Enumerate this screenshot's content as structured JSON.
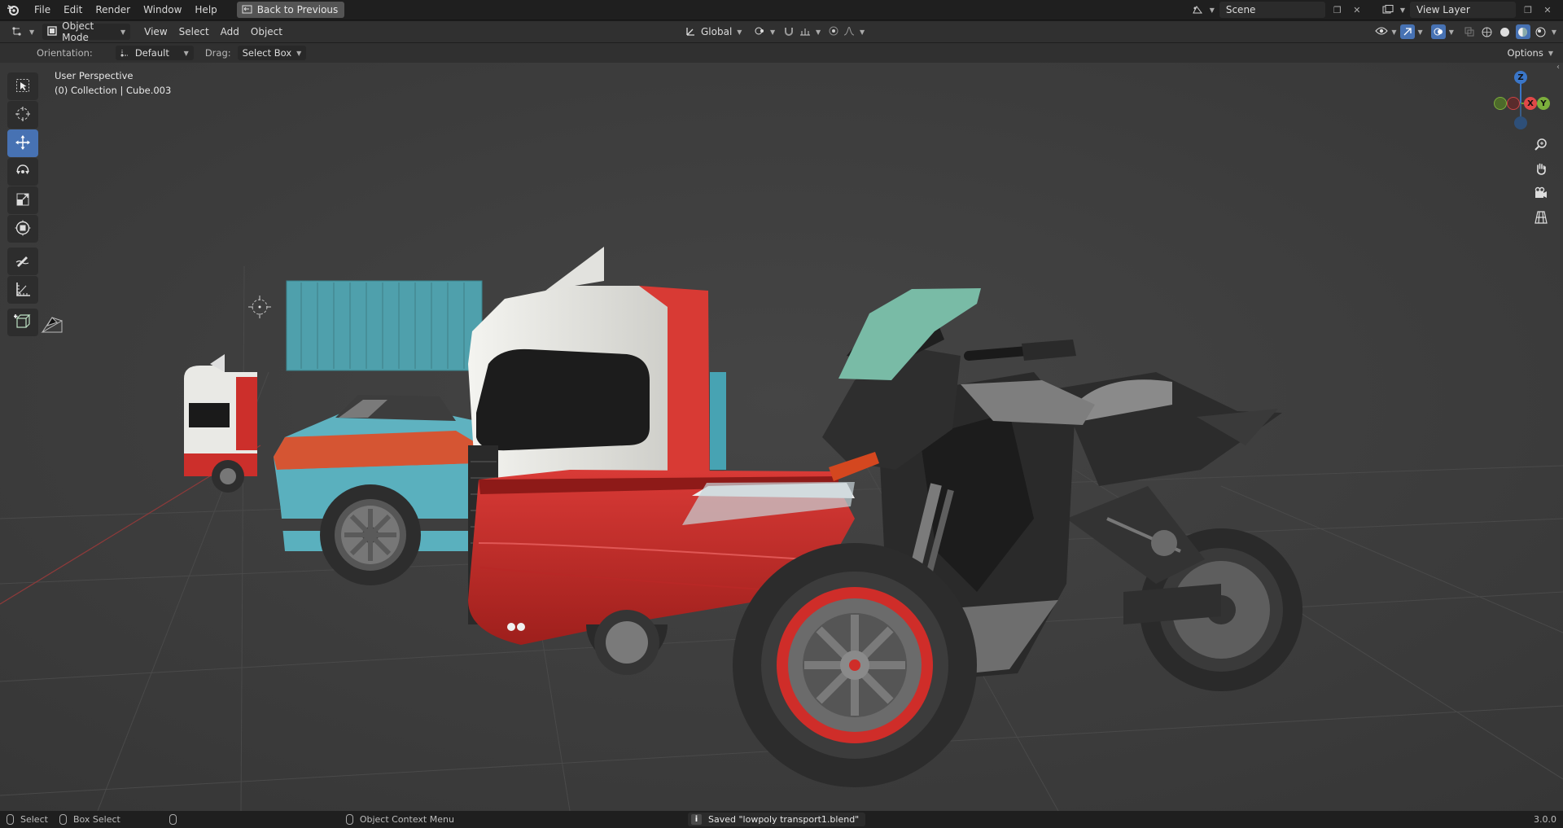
{
  "topbar": {
    "menus": [
      "File",
      "Edit",
      "Render",
      "Window",
      "Help"
    ],
    "back_button": "Back to Previous",
    "scene": "Scene",
    "view_layer": "View Layer"
  },
  "header": {
    "mode": "Object Mode",
    "menus": [
      "View",
      "Select",
      "Add",
      "Object"
    ],
    "transform_orientation": "Global"
  },
  "tool_settings": {
    "orientation_label": "Orientation:",
    "orientation_value": "Default",
    "drag_label": "Drag:",
    "drag_value": "Select Box",
    "options": "Options"
  },
  "viewport": {
    "perspective": "User Perspective",
    "collection_info": "(0) Collection | Cube.003",
    "gizmo_axes": {
      "z": "Z",
      "x": "X",
      "y": "Y"
    },
    "accent_color": "#4772b3"
  },
  "toolbar": {
    "tools": [
      "select-box",
      "cursor",
      "move",
      "rotate",
      "scale",
      "transform",
      "annotate",
      "measure",
      "add-cube"
    ],
    "active_tool": "move"
  },
  "statusbar": {
    "select": "Select",
    "box_select": "Box Select",
    "context_menu": "Object Context Menu",
    "saved_message": "Saved \"lowpoly transport1.blend\"",
    "version": "3.0.0"
  }
}
